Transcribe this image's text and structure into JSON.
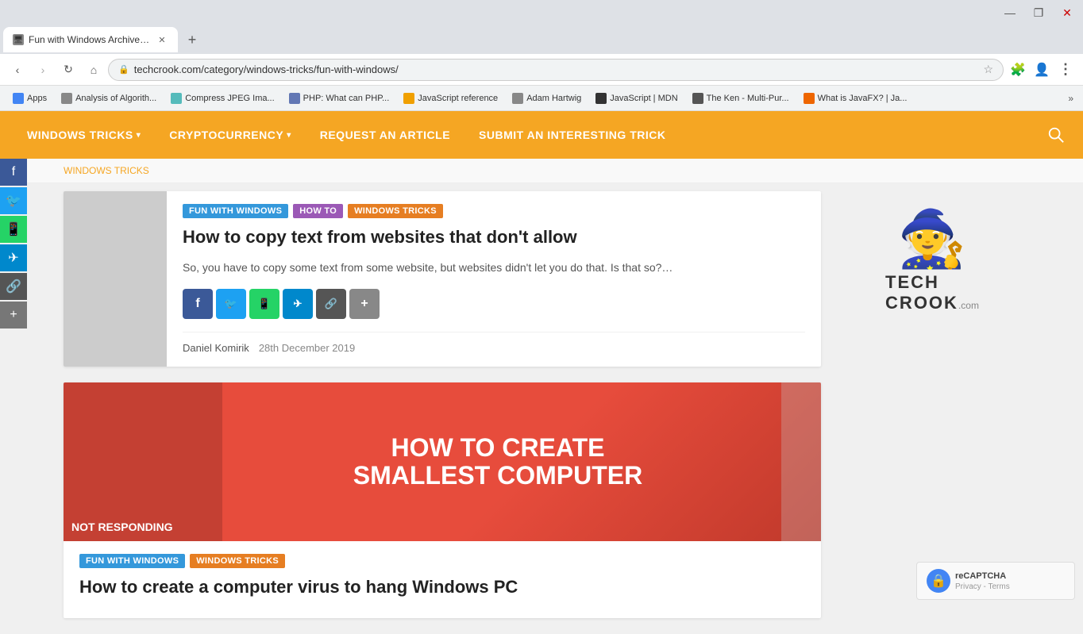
{
  "browser": {
    "tab_title": "Fun with Windows Archives - Tec",
    "tab_favicon": "🖥",
    "new_tab_label": "+",
    "address": "techcrook.com/category/windows-tricks/fun-with-windows/",
    "window_minimize": "—",
    "window_maximize": "❐",
    "window_close": "✕"
  },
  "bookmarks": [
    {
      "id": "apps",
      "label": "Apps",
      "favicon_color": "#4285f4"
    },
    {
      "id": "analysis",
      "label": "Analysis of Algorith...",
      "favicon_color": "#888"
    },
    {
      "id": "compress",
      "label": "Compress JPEG Ima...",
      "favicon_color": "#888"
    },
    {
      "id": "php",
      "label": "PHP: What can PHP...",
      "favicon_color": "#888"
    },
    {
      "id": "js-ref",
      "label": "JavaScript reference",
      "favicon_color": "#f0a"
    },
    {
      "id": "adam",
      "label": "Adam Hartwig",
      "favicon_color": "#888"
    },
    {
      "id": "mdn",
      "label": "JavaScript | MDN",
      "favicon_color": "#333"
    },
    {
      "id": "ken",
      "label": "The Ken - Multi-Pur...",
      "favicon_color": "#888"
    },
    {
      "id": "javafx",
      "label": "What is JavaFX? | Ja...",
      "favicon_color": "#f90"
    }
  ],
  "nav": {
    "items": [
      {
        "id": "windows-tricks",
        "label": "WINDOWS TRICKS",
        "has_dropdown": true
      },
      {
        "id": "cryptocurrency",
        "label": "CRYPTOCURRENCY",
        "has_dropdown": true
      },
      {
        "id": "request",
        "label": "REQUEST AN ARTICLE",
        "has_dropdown": false
      },
      {
        "id": "submit",
        "label": "SUBMIT AN INTERESTING TRICK",
        "has_dropdown": false
      }
    ]
  },
  "breadcrumb": {
    "path": "WINDOWS TRICKS",
    "separator": "»"
  },
  "article1": {
    "tags": [
      {
        "id": "fun-windows",
        "label": "FUN WITH WINDOWS",
        "class": "fun-windows"
      },
      {
        "id": "how-to",
        "label": "HOW TO",
        "class": "how-to"
      },
      {
        "id": "windows-tricks",
        "label": "WINDOWS TRICKS",
        "class": "windows-tricks"
      }
    ],
    "title": "How to copy text from websites that don't allow",
    "excerpt": "So, you have to copy some text from some website, but websites didn't let you do that. Is that so?…",
    "author": "Daniel Komirik",
    "date": "28th December 2019",
    "share_buttons": [
      {
        "id": "fb",
        "label": "f",
        "class": "fb"
      },
      {
        "id": "tw",
        "label": "🐦",
        "class": "tw"
      },
      {
        "id": "wa",
        "label": "📱",
        "class": "wa"
      },
      {
        "id": "tg",
        "label": "✈",
        "class": "tg"
      },
      {
        "id": "cp",
        "label": "🔗",
        "class": "cp"
      },
      {
        "id": "more",
        "label": "+",
        "class": "more"
      }
    ]
  },
  "article2": {
    "tags": [
      {
        "id": "fun-windows",
        "label": "FUN WITH WINDOWS",
        "class": "fun-windows"
      },
      {
        "id": "windows-tricks",
        "label": "WINDOWS TRICKS",
        "class": "windows-tricks"
      }
    ],
    "title": "How to create a computer virus to hang Windows PC",
    "image_text": "HOW TO CREATE SMALLEST COMPUTER",
    "image_subtitle": "NOT RESPONDING"
  },
  "sidebar": {
    "logo_figure": "🧙",
    "logo_text": "TECH CROOK",
    "logo_com": ".com"
  },
  "social_sidebar": {
    "buttons": [
      "f",
      "🐦",
      "📱",
      "✈",
      "🔗",
      "+"
    ]
  },
  "recaptcha": {
    "title": "reCAPTCHA",
    "links": "Privacy - Terms"
  }
}
